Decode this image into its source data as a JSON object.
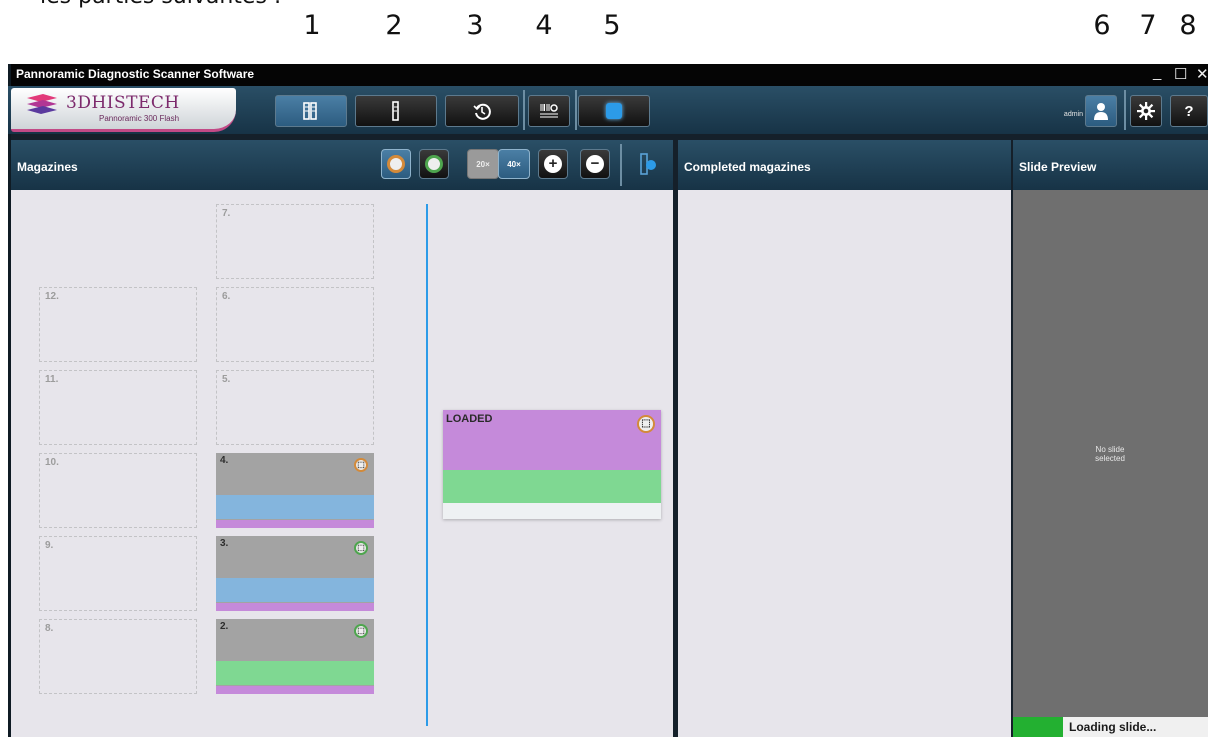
{
  "caption": "les parties suivantes :",
  "callouts": [
    "1",
    "2",
    "3",
    "4",
    "5",
    "6",
    "7",
    "8"
  ],
  "window": {
    "title": "Pannoramic Diagnostic Scanner Software",
    "controls": {
      "minimize": "_",
      "maximize": "☐",
      "close": "✕"
    }
  },
  "logo": {
    "brand": "3DHISTECH",
    "model": "Pannoramic 300 Flash"
  },
  "toolbar": {
    "user_label": "admin",
    "help_label": "?",
    "icons": [
      "magazines-icon",
      "slide-icon",
      "history-icon",
      "barcode-settings-icon",
      "stop-icon",
      "user-icon",
      "gear-icon",
      "help-icon"
    ]
  },
  "magazines": {
    "title": "Magazines",
    "buttons": {
      "zoom20": "20×",
      "zoom40": "40×",
      "add": "+",
      "remove": "−"
    },
    "empty_slots": [
      "7.",
      "12.",
      "6.",
      "11.",
      "5.",
      "10.",
      "9.",
      "8."
    ],
    "filled_slots": [
      {
        "label": "4.",
        "stripe": "blue",
        "icon": "mag-orange"
      },
      {
        "label": "3.",
        "stripe": "blue",
        "icon": "mag-green"
      },
      {
        "label": "2.",
        "stripe": "green",
        "icon": "mag-green"
      }
    ],
    "loaded_label": "LOADED"
  },
  "completed": {
    "title": "Completed magazines"
  },
  "preview": {
    "title": "Slide Preview",
    "empty_line1": "No slide",
    "empty_line2": "selected",
    "status": "Loading slide..."
  },
  "colors": {
    "toolbar_top": "#2a4f66",
    "toolbar_bottom": "#173346",
    "panel_bg": "#e7e5eb",
    "slide_gray": "#a3a3a3",
    "stripe_blue": "#84b5dd",
    "stripe_green": "#7fd892",
    "stripe_purple": "#c58ada",
    "accent_blue": "#2c9be8",
    "status_green": "#23b031"
  }
}
